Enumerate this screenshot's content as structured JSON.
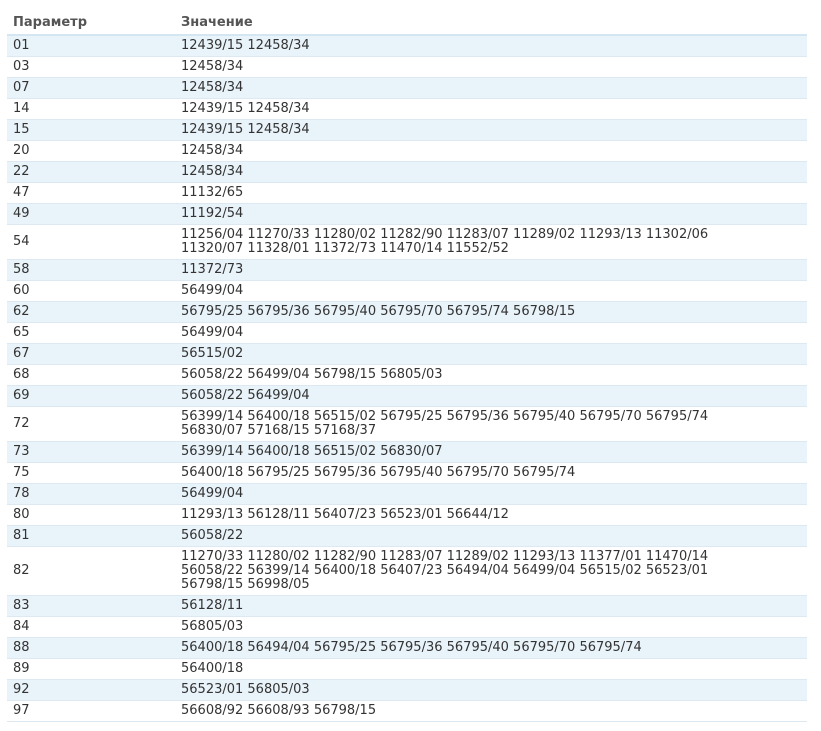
{
  "table": {
    "headers": [
      "Параметр",
      "Значение"
    ],
    "rows": [
      {
        "param": "01",
        "value": "12439/15 12458/34"
      },
      {
        "param": "03",
        "value": "12458/34"
      },
      {
        "param": "07",
        "value": "12458/34"
      },
      {
        "param": "14",
        "value": "12439/15 12458/34"
      },
      {
        "param": "15",
        "value": "12439/15 12458/34"
      },
      {
        "param": "20",
        "value": "12458/34"
      },
      {
        "param": "22",
        "value": "12458/34"
      },
      {
        "param": "47",
        "value": "11132/65"
      },
      {
        "param": "49",
        "value": "11192/54"
      },
      {
        "param": "54",
        "value": "11256/04 11270/33 11280/02 11282/90 11283/07 11289/02 11293/13 11302/06 11320/07 11328/01 11372/73 11470/14 11552/52"
      },
      {
        "param": "58",
        "value": "11372/73"
      },
      {
        "param": "60",
        "value": "56499/04"
      },
      {
        "param": "62",
        "value": "56795/25 56795/36 56795/40 56795/70 56795/74 56798/15"
      },
      {
        "param": "65",
        "value": "56499/04"
      },
      {
        "param": "67",
        "value": "56515/02"
      },
      {
        "param": "68",
        "value": "56058/22 56499/04 56798/15 56805/03"
      },
      {
        "param": "69",
        "value": "56058/22 56499/04"
      },
      {
        "param": "72",
        "value": "56399/14 56400/18 56515/02 56795/25 56795/36 56795/40 56795/70 56795/74 56830/07 57168/15 57168/37"
      },
      {
        "param": "73",
        "value": "56399/14 56400/18 56515/02 56830/07"
      },
      {
        "param": "75",
        "value": "56400/18 56795/25 56795/36 56795/40 56795/70 56795/74"
      },
      {
        "param": "78",
        "value": "56499/04"
      },
      {
        "param": "80",
        "value": "11293/13 56128/11 56407/23 56523/01 56644/12"
      },
      {
        "param": "81",
        "value": "56058/22"
      },
      {
        "param": "82",
        "value": "11270/33 11280/02 11282/90 11283/07 11289/02 11293/13 11377/01 11470/14 56058/22 56399/14 56400/18 56407/23 56494/04 56499/04 56515/02 56523/01 56798/15 56998/05"
      },
      {
        "param": "83",
        "value": "56128/11"
      },
      {
        "param": "84",
        "value": "56805/03"
      },
      {
        "param": "88",
        "value": "56400/18 56494/04 56795/25 56795/36 56795/40 56795/70 56795/74"
      },
      {
        "param": "89",
        "value": "56400/18"
      },
      {
        "param": "92",
        "value": "56523/01 56805/03"
      },
      {
        "param": "97",
        "value": "56608/92 56608/93 56798/15"
      }
    ]
  }
}
